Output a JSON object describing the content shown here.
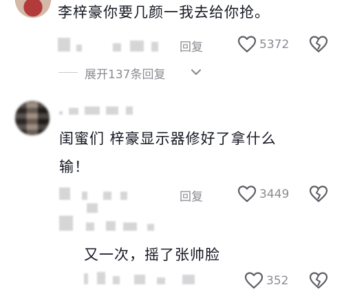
{
  "comment1": {
    "text": "李梓豪你要几颜一我去给你抢。",
    "meta_blur": "▯ ▯▯ ▯ ▯▯匕",
    "reply_label": "回复",
    "like_count": "5372"
  },
  "expand": {
    "label": "展开137条回复"
  },
  "comment2": {
    "username_blur": "▪ ▪▪▪ ▪",
    "text_line1": "闺蜜们 梓豪显示器修好了拿什么",
    "text_line2": "输！",
    "meta_blur": "㕣 ▯ ▯ ▯ ▯▯⊃",
    "reply_label": "回复",
    "like_count": "3449"
  },
  "reply1": {
    "username_blur": "▪ ▪ ▪▪ ▪",
    "text": "又一次，摇了张帅脸",
    "meta_blur": "▯ ▯▯ ▯▯ ▯ ▯ ▯▯",
    "like_count": "352"
  },
  "colors": {
    "text": "#161823",
    "muted": "#8a8b91",
    "divider": "#c9c9cc"
  },
  "icons": [
    "heart-outline-icon",
    "broken-heart-icon",
    "chevron-down-icon"
  ]
}
